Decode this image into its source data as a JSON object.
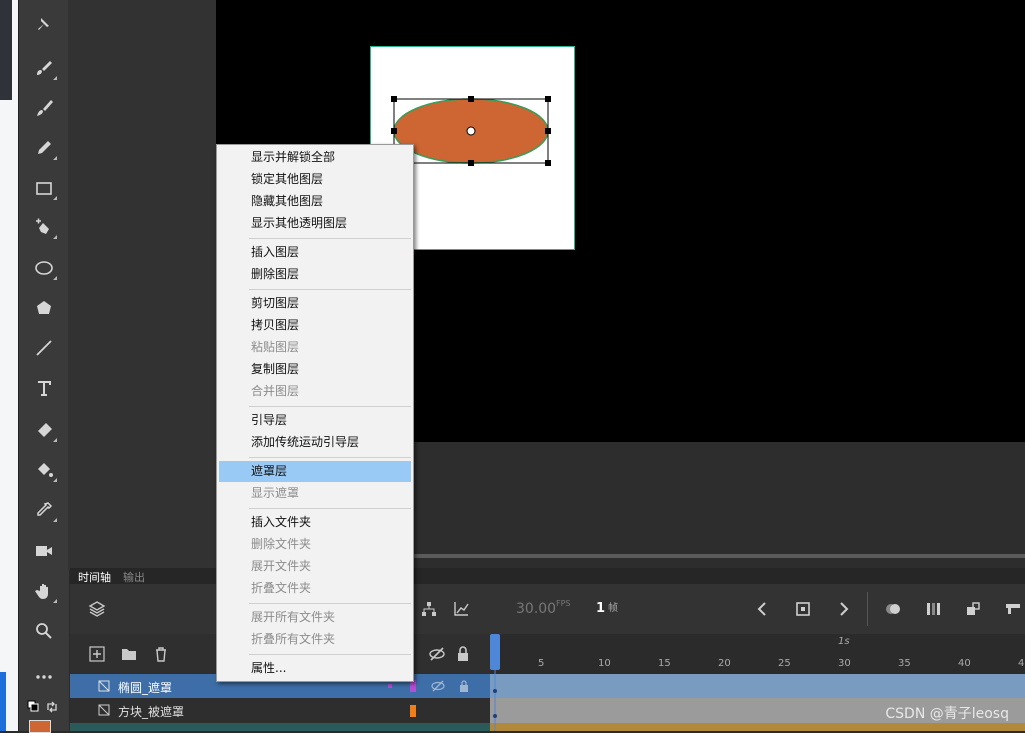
{
  "timeline": {
    "tab_timeline": "时间轴",
    "tab_output": "输出",
    "fps_value": "30.00",
    "fps_unit": "FPS",
    "frame_value": "1",
    "frame_unit": "帧",
    "ruler_label_1s": "1s",
    "ticks": [
      "5",
      "10",
      "15",
      "20",
      "25",
      "30",
      "35",
      "40",
      "4"
    ],
    "layers": [
      {
        "name": "椭圆_遮罩",
        "selected": true
      },
      {
        "name": "方块_被遮罩",
        "selected": false
      }
    ]
  },
  "context_menu": {
    "items": [
      {
        "label": "显示并解锁全部",
        "enabled": true
      },
      {
        "label": "锁定其他图层",
        "enabled": true
      },
      {
        "label": "隐藏其他图层",
        "enabled": true
      },
      {
        "label": "显示其他透明图层",
        "enabled": true
      },
      {
        "label": "插入图层",
        "enabled": true
      },
      {
        "label": "删除图层",
        "enabled": true
      },
      {
        "label": "剪切图层",
        "enabled": true
      },
      {
        "label": "拷贝图层",
        "enabled": true
      },
      {
        "label": "粘贴图层",
        "enabled": false
      },
      {
        "label": "复制图层",
        "enabled": true
      },
      {
        "label": "合并图层",
        "enabled": false
      },
      {
        "label": "引导层",
        "enabled": true
      },
      {
        "label": "添加传统运动引导层",
        "enabled": true
      },
      {
        "label": "遮罩层",
        "enabled": true,
        "highlighted": true
      },
      {
        "label": "显示遮罩",
        "enabled": false
      },
      {
        "label": "插入文件夹",
        "enabled": true
      },
      {
        "label": "删除文件夹",
        "enabled": false
      },
      {
        "label": "展开文件夹",
        "enabled": false
      },
      {
        "label": "折叠文件夹",
        "enabled": false
      },
      {
        "label": "展开所有文件夹",
        "enabled": false
      },
      {
        "label": "折叠所有文件夹",
        "enabled": false
      },
      {
        "label": "属性...",
        "enabled": true
      }
    ]
  },
  "tools": [
    "pin-icon",
    "paint-brush-icon",
    "brush-icon",
    "pencil-icon",
    "rectangle-icon",
    "add-anchor-pen-icon",
    "oval-icon",
    "polygon-icon",
    "line-icon",
    "text-icon",
    "eraser-icon",
    "paint-bucket-icon",
    "eyedropper-icon",
    "camera-icon",
    "hand-icon",
    "zoom-icon",
    "more-icon"
  ],
  "colors": {
    "ellipse_fill": "#cd6632",
    "ellipse_stroke": "#3a9c5a",
    "fill_swatch": "#cd6632",
    "menu_highlight": "#99c9f5",
    "layer_selected": "#3d6ea8"
  },
  "watermark": "CSDN @青子leosq"
}
